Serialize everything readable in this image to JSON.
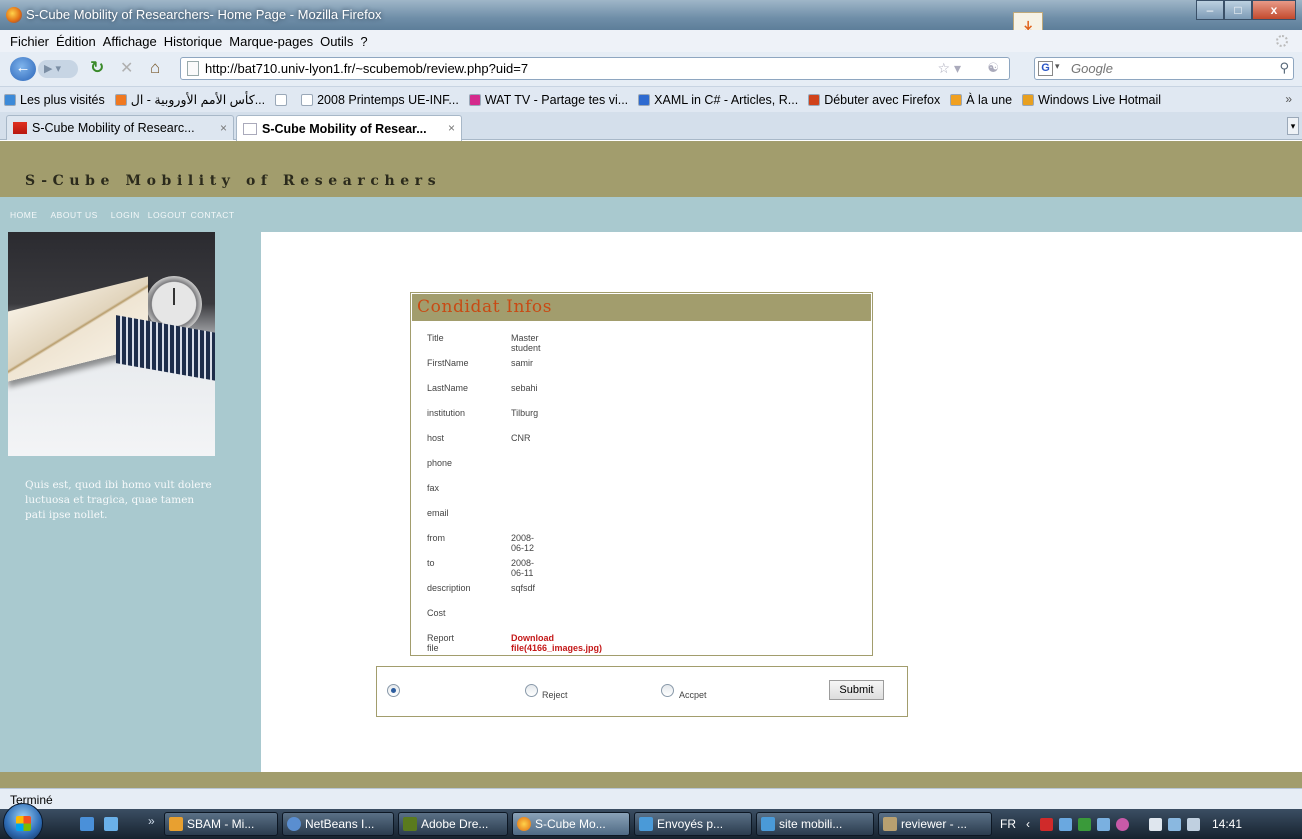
{
  "window": {
    "title": "S-Cube Mobility of Researchers- Home Page - Mozilla Firefox",
    "controls": {
      "minimize": "–",
      "maximize": "□",
      "close": "x"
    }
  },
  "menu": [
    "Fichier",
    "Édition",
    "Affichage",
    "Historique",
    "Marque-pages",
    "Outils",
    "?"
  ],
  "nav": {
    "url": "http://bat710.univ-lyon1.fr/~scubemob/review.php?uid=7",
    "search_placeholder": "Google"
  },
  "bookmarks": [
    {
      "label": "Les plus visités",
      "color": "#3c8ad8"
    },
    {
      "label": "كأس الأمم الأوروبية - ال...",
      "color": "#f07820"
    },
    {
      "label": "",
      "color": "#ffffff"
    },
    {
      "label": "2008 Printemps UE-INF...",
      "color": "#ffffff"
    },
    {
      "label": "WAT TV - Partage tes vi...",
      "color": "#d42a8c"
    },
    {
      "label": "XAML in C# - Articles, R...",
      "color": "#2e6ad0"
    },
    {
      "label": "Débuter avec Firefox",
      "color": "#d0421a"
    },
    {
      "label": "À la une",
      "color": "#f0a020"
    },
    {
      "label": "Windows Live Hotmail",
      "color": "#e8a020"
    }
  ],
  "tabs": [
    {
      "label": "S-Cube Mobility of Researc...",
      "active": false
    },
    {
      "label": "S-Cube Mobility of Resear...",
      "active": true
    }
  ],
  "site": {
    "title": "S-Cube Mobility of Researchers",
    "nav": [
      "HOME",
      "ABOUT US",
      "LOGIN",
      "LOGOUT",
      "CONTACT"
    ],
    "sidebar_text": "Quis est, quod ibi homo vult dolere luctuosa et tragica, quae tamen pati ipse nollet."
  },
  "candidate": {
    "heading": "Condidat Infos",
    "rows": [
      {
        "label": "Title",
        "value": "Master student"
      },
      {
        "label": "FirstName",
        "value": "samir"
      },
      {
        "label": "LastName",
        "value": "sebahi"
      },
      {
        "label": "institution",
        "value": "Tilburg"
      },
      {
        "label": "host",
        "value": "CNR"
      },
      {
        "label": "phone",
        "value": ""
      },
      {
        "label": "fax",
        "value": ""
      },
      {
        "label": "email",
        "value": ""
      },
      {
        "label": "from",
        "value": "2008-06-12"
      },
      {
        "label": "to",
        "value": "2008-06-11"
      },
      {
        "label": "description",
        "value": "sqfsdf"
      },
      {
        "label": "Cost",
        "value": ""
      },
      {
        "label": "Report file",
        "value": "Download file(4166_images.jpg)"
      }
    ]
  },
  "decision": {
    "options": [
      {
        "label": "",
        "checked": true
      },
      {
        "label": "Reject",
        "checked": false
      },
      {
        "label": "Accpet",
        "checked": false
      }
    ],
    "submit_label": "Submit"
  },
  "status": "Terminé",
  "taskbar": {
    "tasks": [
      "SBAM - Mi...",
      "NetBeans I...",
      "Adobe Dre...",
      "S-Cube Mo...",
      "Envoyés p...",
      "site mobili...",
      "reviewer - ..."
    ],
    "language": "FR",
    "time": "14:41"
  }
}
